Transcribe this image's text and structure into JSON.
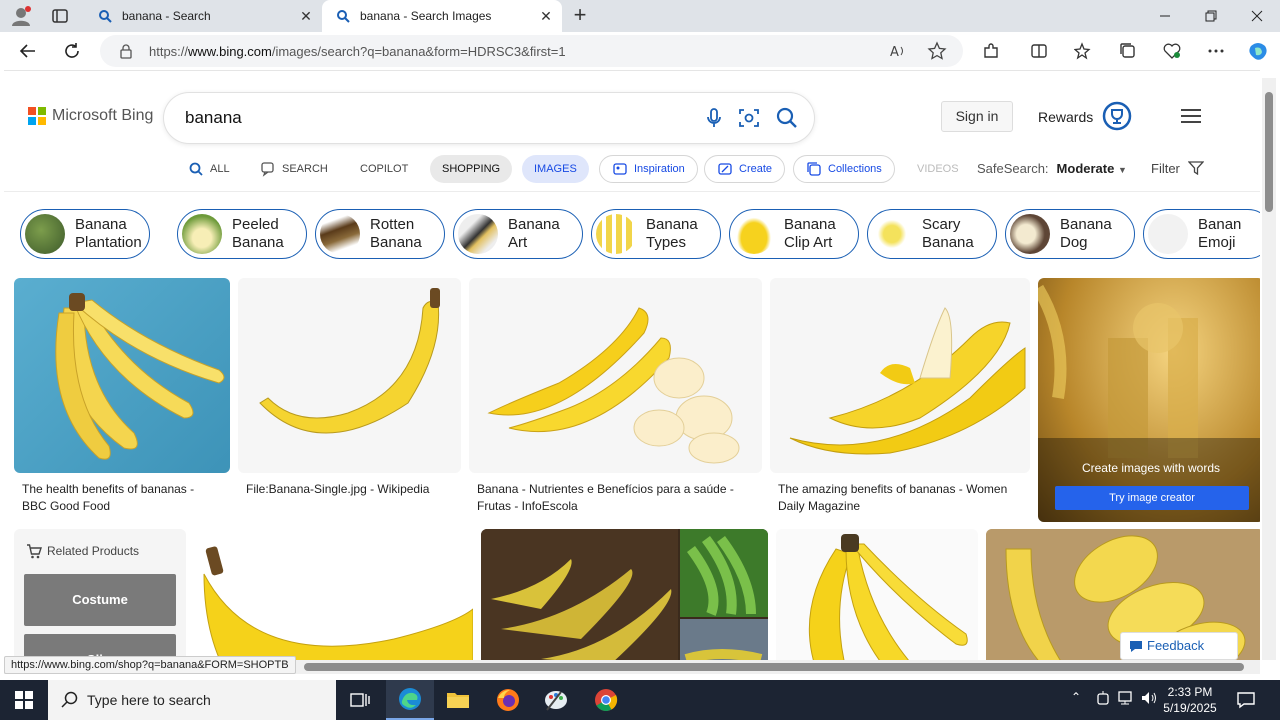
{
  "browser": {
    "tabs": [
      {
        "title": "banana - Search",
        "active": false
      },
      {
        "title": "banana - Search Images",
        "active": true
      }
    ],
    "url_prefix": "https://",
    "url_domain": "www.bing.com",
    "url_rest": "/images/search?q=banana&form=HDRSC3&first=1"
  },
  "bing": {
    "logo_text": "Microsoft Bing",
    "query": "banana",
    "signin_label": "Sign in",
    "rewards_label": "Rewards",
    "nav": {
      "all": "ALL",
      "search": "SEARCH",
      "copilot": "COPILOT",
      "shopping": "SHOPPING",
      "images": "IMAGES",
      "inspiration": "Inspiration",
      "create": "Create",
      "collections": "Collections",
      "videos": "VIDEOS"
    },
    "safesearch_label": "SafeSearch:",
    "safesearch_value": "Moderate",
    "filter_label": "Filter"
  },
  "chips": [
    {
      "label": "Banana\nPlantation",
      "color": "#5a7a3a"
    },
    {
      "label": "Peeled\nBanana",
      "color": "#8fb24a"
    },
    {
      "label": "Rotten\nBanana",
      "color": "#6b4a22"
    },
    {
      "label": "Banana\nArt",
      "color": "#3a3a3a"
    },
    {
      "label": "Banana\nTypes",
      "color": "#e7c93a"
    },
    {
      "label": "Banana\nClip Art",
      "color": "#f3d12a"
    },
    {
      "label": "Scary\nBanana",
      "color": "#f2e36a"
    },
    {
      "label": "Banana\nDog",
      "color": "#6a5545"
    },
    {
      "label": "Banan\nEmoji",
      "color": "#f5f5f5"
    }
  ],
  "results": [
    {
      "caption": "The health benefits of bananas - BBC Good Food"
    },
    {
      "caption": "File:Banana-Single.jpg - Wikipedia"
    },
    {
      "caption": "Banana - Nutrientes e Benefícios para a saúde - Frutas - InfoEscola"
    },
    {
      "caption": "The amazing benefits of bananas - Women Daily Magazine"
    }
  ],
  "creator": {
    "text": "Create images with words",
    "button": "Try image creator"
  },
  "related": {
    "title": "Related Products",
    "items": [
      "Costume",
      "Cli..."
    ]
  },
  "feedback_label": "Feedback",
  "status_url": "https://www.bing.com/shop?q=banana&FORM=SHOPTB",
  "taskbar": {
    "search_placeholder": "Type here to search",
    "time": "2:33 PM",
    "date": "5/19/2025"
  }
}
